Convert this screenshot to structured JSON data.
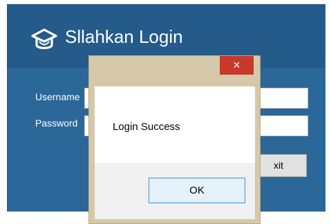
{
  "login_window": {
    "title": "Sllahkan Login",
    "username_label": "Username",
    "password_label": "Password",
    "exit_label": "xit",
    "logo_icon": "graduation-cap-icon",
    "colors": {
      "header": "#245b8a",
      "body": "#2b6798"
    }
  },
  "message_box": {
    "close_label": "×",
    "message": "Login Success",
    "ok_label": "OK",
    "colors": {
      "frame": "#d6c9a9",
      "close": "#c7392a"
    }
  }
}
